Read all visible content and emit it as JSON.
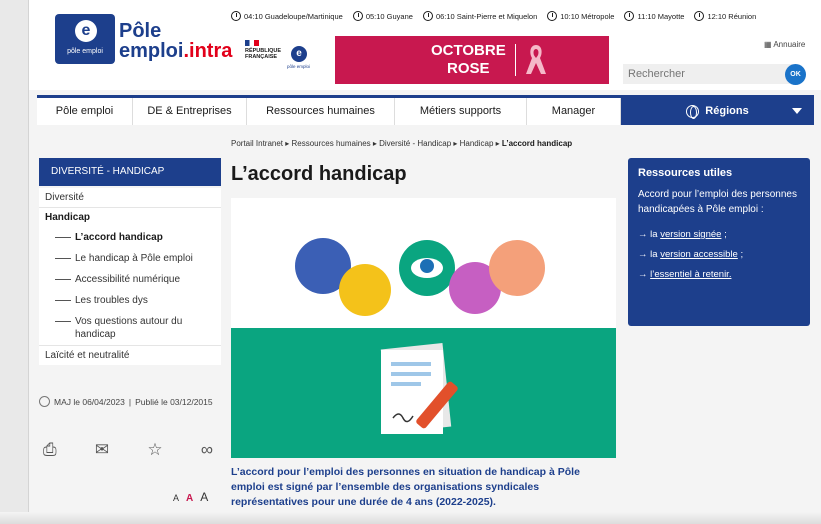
{
  "header": {
    "logo_small": "pôle emploi",
    "logo_line1": "Pôle",
    "logo_line2_a": "emploi",
    "logo_line2_b": ".intra",
    "clocks": [
      "04:10 Guadeloupe/Martinique",
      "05:10 Guyane",
      "06:10 Saint-Pierre et Miquelon",
      "10:10 Métropole",
      "11:10 Mayotte",
      "12:10 Réunion"
    ],
    "republique": "RÉPUBLIQUE\nFRANÇAISE",
    "pe_small": "pôle emploi",
    "banner_line1": "OCTOBRE",
    "banner_line2": "ROSE",
    "annuaire": "Annuaire",
    "search_placeholder": "Rechercher",
    "search_button": "OK"
  },
  "nav": {
    "items": [
      "Pôle emploi",
      "DE & Entreprises",
      "Ressources humaines",
      "Métiers supports",
      "Manager"
    ],
    "regions": "Régions"
  },
  "sidebar": {
    "title": "DIVERSITÉ - HANDICAP",
    "diversite": "Diversité",
    "handicap": "Handicap",
    "sub": [
      "L’accord handicap",
      "Le handicap à Pôle emploi",
      "Accessibilité numérique",
      "Les troubles dys",
      "Vos questions autour du handicap"
    ],
    "laicite": "Laïcité et neutralité",
    "maj": "MAJ le 06/04/2023",
    "publie": "Publié le 03/12/2015",
    "font_sizes": [
      "A",
      "A",
      "A"
    ]
  },
  "main": {
    "breadcrumb": [
      "Portail Intranet",
      "Ressources humaines",
      "Diversité - Handicap",
      "Handicap",
      "L’accord handicap"
    ],
    "title": "L’accord handicap",
    "lead": "L’accord pour l’emploi des personnes en situation de handicap à Pôle emploi est signé par l’ensemble des organisations syndicales représentatives pour une durée de 4 ans (2022-2025)."
  },
  "resources": {
    "title": "Ressources utiles",
    "desc": "Accord pour l’emploi des personnes handicapées à Pôle emploi :",
    "link1_pre": "→ la ",
    "link1": "version signée",
    "link1_post": " ;",
    "link2_pre": "→ la ",
    "link2": "version accessible",
    "link2_post": " ;",
    "link3_pre": "→ ",
    "link3": "l’essentiel à retenir."
  },
  "colors": {
    "brand_blue": "#1d3f8c",
    "brand_red": "#e2001a",
    "rose": "#c8184f",
    "green": "#0aa580"
  }
}
